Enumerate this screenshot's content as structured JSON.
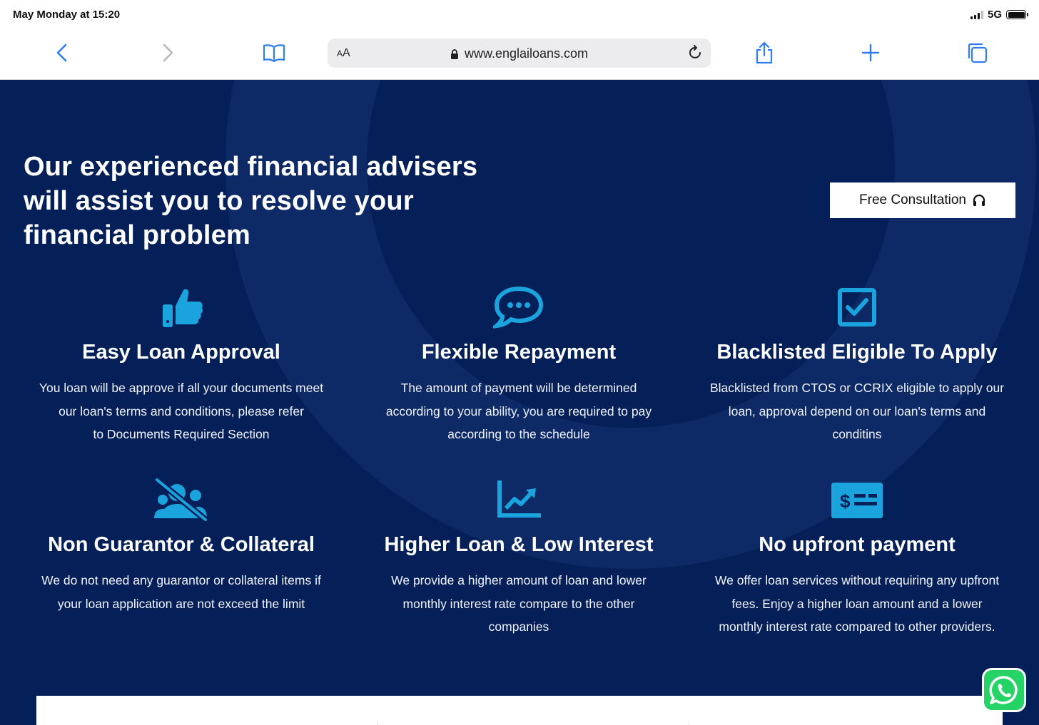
{
  "status_bar": {
    "time": "May Monday at 15:20",
    "network": "5G"
  },
  "browser": {
    "reader_label_big": "A",
    "reader_label_small": "A",
    "url": "www.englailoans.com",
    "icons": [
      "back-icon",
      "forward-icon",
      "bookmarks-icon",
      "lock-icon",
      "reload-icon",
      "share-icon",
      "new-tab-icon",
      "tabs-icon"
    ]
  },
  "hero": {
    "headline_lines": [
      "Our experienced financial advisers",
      "will assist you to resolve your",
      "financial problem"
    ],
    "cta_label": "Free Consultation"
  },
  "features": [
    {
      "icon": "thumbs-up-icon",
      "title": "Easy Loan Approval",
      "description_lines": [
        "You loan will be approve if all your documents meet",
        "our loan's terms and conditions, please refer",
        "to Documents Required Section"
      ]
    },
    {
      "icon": "chat-bubble-icon",
      "title": "Flexible Repayment",
      "description_lines": [
        "The amount of payment will be determined",
        "according to your ability, you are required to pay",
        "according to the schedule"
      ]
    },
    {
      "icon": "checkbox-icon",
      "title": "Blacklisted Eligible To Apply",
      "description_lines": [
        "Blacklisted from CTOS or CCRIX eligible to apply our",
        "loan, approval depend on our loan's terms and",
        "conditins"
      ]
    },
    {
      "icon": "no-users-icon",
      "title": "Non Guarantor & Collateral",
      "description_lines": [
        "We do not need any guarantor or collateral items if",
        "your loan application are not exceed the limit"
      ]
    },
    {
      "icon": "chart-up-icon",
      "title": "Higher Loan & Low Interest",
      "description_lines": [
        "We provide a higher amount of loan and lower",
        "monthly interest rate compare to the other",
        "companies"
      ]
    },
    {
      "icon": "money-check-icon",
      "title": "No upfront payment",
      "description_lines": [
        "We offer loan services without requiring any upfront",
        "fees. Enjoy a higher loan amount and a lower",
        "monthly interest rate compared to other providers."
      ]
    }
  ],
  "colors": {
    "page_background": "#052058",
    "ring": "#0d2a66",
    "icon_accent": "#1aa3dc",
    "whatsapp": "#25d366"
  }
}
